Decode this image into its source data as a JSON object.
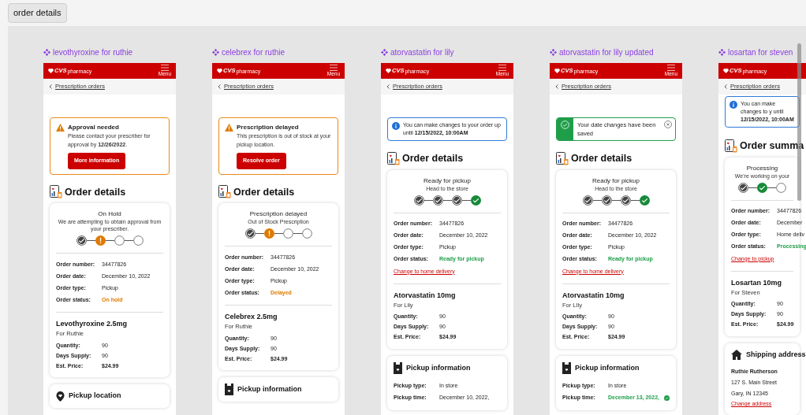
{
  "page_button": "order details",
  "frames": [
    {
      "title": "levothyroxine for ruthie",
      "scrolled": false,
      "header": {
        "logo": "CVS",
        "logo_suffix": "pharmacy",
        "menu_label": "Menu"
      },
      "back_link": "Prescription orders",
      "banner": {
        "kind": "warning",
        "title": "Approval needed",
        "text": "Please contact your prescriber for approval by **12/26/2022**.",
        "button": "More information"
      },
      "heading": "Order details",
      "status": {
        "title": "On Hold",
        "subtitle": "We are attempting to obtain approval from your prescriber.",
        "steps": [
          {
            "kind": "done"
          },
          {
            "kind": "alert"
          },
          {
            "kind": "pending"
          },
          {
            "kind": "pending"
          }
        ]
      },
      "details": [
        {
          "label": "Order number:",
          "value": "34477826",
          "kind": "plain"
        },
        {
          "label": "Order date:",
          "value": "December 10, 2022",
          "kind": "plain"
        },
        {
          "label": "Order type:",
          "value": "Pickup",
          "kind": "plain"
        },
        {
          "label": "Order status:",
          "value": "On hold",
          "kind": "warning"
        }
      ],
      "medication": {
        "name": "Levothyroxine 2.5mg",
        "for": "For Ruthie",
        "rows": [
          {
            "label": "Quantity:",
            "value": "90"
          },
          {
            "label": "Days Supply:",
            "value": "90"
          },
          {
            "label": "Est. Price:",
            "value": "$24.99"
          }
        ]
      },
      "section": {
        "kind": "location",
        "title": "Pickup location"
      }
    },
    {
      "title": "celebrex for ruthie",
      "scrolled": false,
      "header": {
        "logo": "CVS",
        "logo_suffix": "pharmacy",
        "menu_label": "Menu"
      },
      "back_link": "Prescription orders",
      "banner": {
        "kind": "warning",
        "title": "Prescription delayed",
        "text": "This prescription is  out of stock at your pickup location.",
        "button": "Resolve order"
      },
      "heading": "Order details",
      "status": {
        "title": "Prescription delayed",
        "subtitle": "Out of Stock Prescription",
        "steps": [
          {
            "kind": "done"
          },
          {
            "kind": "alert"
          },
          {
            "kind": "pending"
          },
          {
            "kind": "pending"
          }
        ]
      },
      "details": [
        {
          "label": "Order number:",
          "value": "34477826",
          "kind": "plain"
        },
        {
          "label": "Order date:",
          "value": "December 10, 2022",
          "kind": "plain"
        },
        {
          "label": "Order type:",
          "value": "Pickup",
          "kind": "plain"
        },
        {
          "label": "Order status:",
          "value": "Delayed",
          "kind": "warning"
        }
      ],
      "medication": {
        "name": "Celebrex 2.5mg",
        "for": "For Ruthie",
        "rows": [
          {
            "label": "Quantity:",
            "value": "90"
          },
          {
            "label": "Days Supply:",
            "value": "90"
          },
          {
            "label": "Est. Price:",
            "value": "$24.99"
          }
        ]
      },
      "section": {
        "kind": "pickup",
        "title": "Pickup information"
      }
    },
    {
      "title": "atorvastatin for lily",
      "scrolled": false,
      "header": {
        "logo": "CVS",
        "logo_suffix": "pharmacy",
        "menu_label": "Menu"
      },
      "back_link": "Prescription orders",
      "banner": {
        "kind": "info",
        "text": "You can make changes to your order up until **12/15/2022, 10:00AM**"
      },
      "heading": "Order details",
      "status": {
        "title": "Ready for pickup",
        "subtitle": "Head to the store",
        "steps": [
          {
            "kind": "done"
          },
          {
            "kind": "done"
          },
          {
            "kind": "done"
          },
          {
            "kind": "complete"
          }
        ]
      },
      "details": [
        {
          "label": "Order number:",
          "value": "34477826",
          "kind": "plain"
        },
        {
          "label": "Order date:",
          "value": "December 10, 2022",
          "kind": "plain"
        },
        {
          "label": "Order type:",
          "value": "Pickup",
          "kind": "plain"
        },
        {
          "label": "Order status:",
          "value": "Ready for pickup",
          "kind": "success"
        }
      ],
      "change_link": "Change to home delivery",
      "medication": {
        "name": "Atorvastatin 10mg",
        "for": "For Lily",
        "rows": [
          {
            "label": "Quantity:",
            "value": "90"
          },
          {
            "label": "Days Supply:",
            "value": "90"
          },
          {
            "label": "Est. Price:",
            "value": "$24.99"
          }
        ]
      },
      "section": {
        "kind": "pickup",
        "title": "Pickup information",
        "rows": [
          {
            "label": "Pickup type:",
            "value": "In store",
            "kind": "plain",
            "edited": false
          },
          {
            "label": "Pickup time:",
            "value": "December 10, 2022,",
            "kind": "plain",
            "edited": false
          }
        ]
      }
    },
    {
      "title": "atorvastatin for lily updated",
      "scrolled": false,
      "header": {
        "logo": "CVS",
        "logo_suffix": "pharmacy",
        "menu_label": "Menu"
      },
      "back_link": "Prescription orders",
      "banner": {
        "kind": "success",
        "text": "Your date changes have been saved"
      },
      "heading": "Order details",
      "status": {
        "title": "Ready for pickup",
        "subtitle": "Head to the store",
        "steps": [
          {
            "kind": "done"
          },
          {
            "kind": "done"
          },
          {
            "kind": "done"
          },
          {
            "kind": "complete"
          }
        ]
      },
      "details": [
        {
          "label": "Order number:",
          "value": "34477826",
          "kind": "plain"
        },
        {
          "label": "Order date:",
          "value": "December 10, 2022",
          "kind": "plain"
        },
        {
          "label": "Order type:",
          "value": "Pickup",
          "kind": "plain"
        },
        {
          "label": "Order status:",
          "value": "Ready for pickup",
          "kind": "success"
        }
      ],
      "change_link": "Change to home delivery",
      "medication": {
        "name": "Atorvastatin 10mg",
        "for": "For LIly",
        "rows": [
          {
            "label": "Quantity:",
            "value": "90"
          },
          {
            "label": "Days Supply:",
            "value": "90"
          },
          {
            "label": "Est. Price:",
            "value": "$24.99"
          }
        ]
      },
      "section": {
        "kind": "pickup",
        "title": "Pickup information",
        "rows": [
          {
            "label": "Pickup type:",
            "value": "In store",
            "kind": "plain",
            "edited": false
          },
          {
            "label": "Pickup time:",
            "value": "December 13, 2022,",
            "kind": "success",
            "edited": true
          }
        ]
      }
    },
    {
      "title": "losartan for steven",
      "scrolled": true,
      "header": {
        "logo": "CVS",
        "logo_suffix": "pharmacy"
      },
      "back_link": "Prescription orders",
      "banner": {
        "kind": "info",
        "text": "You can make changes to y until **12/15/2022, 10:00AM**"
      },
      "heading": "Order summa",
      "status": {
        "title": "Processing",
        "subtitle": "We're working on your",
        "steps": [
          {
            "kind": "done"
          },
          {
            "kind": "complete"
          },
          {
            "kind": "pending"
          }
        ]
      },
      "details": [
        {
          "label": "Order number:",
          "value": "34477826",
          "kind": "plain"
        },
        {
          "label": "Order date:",
          "value": "December",
          "kind": "plain"
        },
        {
          "label": "Order type:",
          "value": "Home deliv",
          "kind": "plain"
        },
        {
          "label": "Order status:",
          "value": "Processing",
          "kind": "success"
        }
      ],
      "change_link": "Change to pickup",
      "medication": {
        "name": "Losartan 10mg",
        "for": "For Steven",
        "rows": [
          {
            "label": "Quantity:",
            "value": "90"
          },
          {
            "label": "Days Supply:",
            "value": "90"
          },
          {
            "label": "Est. Price:",
            "value": "$24.99"
          }
        ]
      },
      "section": {
        "kind": "shipping",
        "title": "Shipping address",
        "lines": [
          {
            "text": "Ruthie Rutherson",
            "kind": "name"
          },
          {
            "text": "127 S. Main Street",
            "kind": "line"
          },
          {
            "text": "Gary, IN 12345",
            "kind": "line"
          }
        ],
        "link": "Change address"
      }
    }
  ]
}
